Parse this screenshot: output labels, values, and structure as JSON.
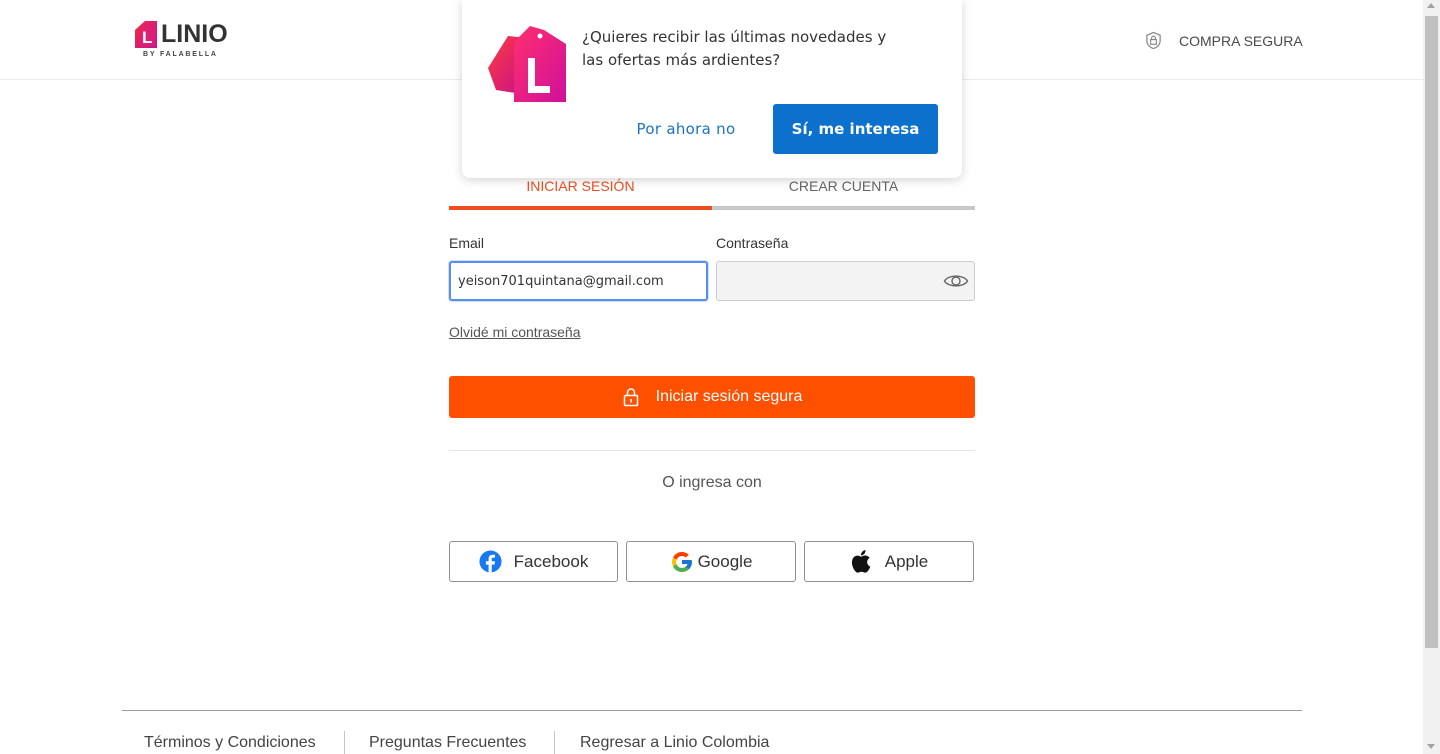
{
  "header": {
    "logo_word": "LINIO",
    "logo_sub": "BY FALABELLA",
    "secure_label": "COMPRA SEGURA",
    "icons": {
      "logo": "linio-logo",
      "secure": "shield-lock-icon"
    }
  },
  "popup": {
    "message": "¿Quieres recibir las últimas novedades y las ofertas más ardientes?",
    "later_label": "Por ahora no",
    "accept_label": "Sí, me interesa",
    "icon": "linio-tag-icon"
  },
  "tabs": [
    {
      "label": "INICIAR SESIÓN",
      "active": true
    },
    {
      "label": "CREAR CUENTA",
      "active": false
    }
  ],
  "form": {
    "email_label": "Email",
    "email_value": "yeison701quintana@gmail.com",
    "password_label": "Contraseña",
    "password_value": "",
    "forgot_label": "Olvidé mi contraseña",
    "submit_label": "Iniciar sesión segura",
    "or_label": "O ingresa con",
    "icons": {
      "toggle_password": "eye-icon",
      "submit": "lock-icon"
    }
  },
  "social": [
    {
      "label": "Facebook",
      "icon": "facebook-icon"
    },
    {
      "label": "Google",
      "icon": "google-icon"
    },
    {
      "label": "Apple",
      "icon": "apple-icon"
    }
  ],
  "footer": {
    "links": [
      "Términos y Condiciones",
      "Preguntas Frecuentes",
      "Regresar a Linio Colombia"
    ]
  },
  "colors": {
    "accent_orange": "#ff5000",
    "tab_active": "#f04e1e",
    "popup_button": "#0b71cc",
    "link_blue": "#1a73c5"
  }
}
